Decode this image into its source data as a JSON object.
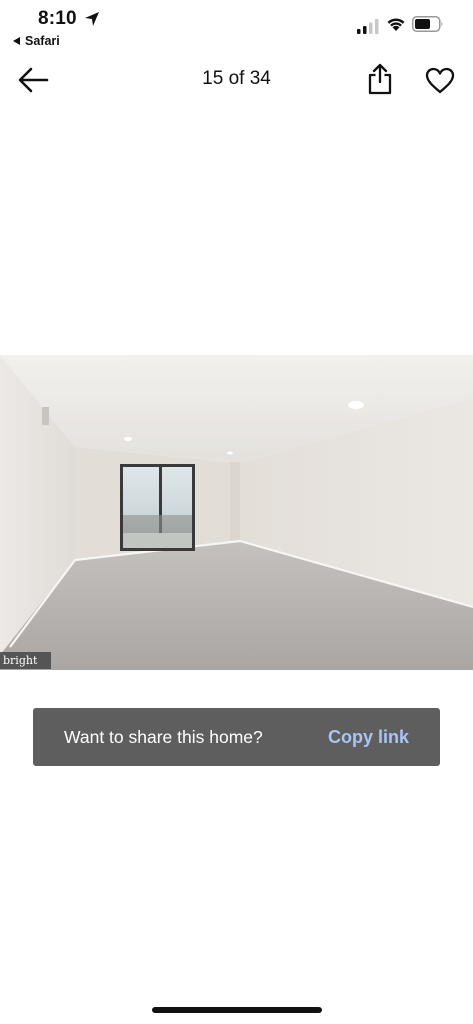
{
  "status_bar": {
    "time": "8:10",
    "back_app_label": "Safari",
    "location_icon": "location-arrow-icon",
    "signal_icon": "cellular-signal-icon",
    "wifi_icon": "wifi-icon",
    "battery_icon": "battery-icon"
  },
  "nav": {
    "back_icon": "arrow-left-icon",
    "counter": "15 of 34",
    "share_icon": "share-icon",
    "favorite_icon": "heart-icon"
  },
  "photo": {
    "subject": "empty carpeted room with window",
    "watermark": "bright MLS"
  },
  "toast": {
    "message": "Want to share this home?",
    "action": "Copy link"
  },
  "colors": {
    "toast_bg": "#5e5e5e",
    "link": "#a8c5f5",
    "wall": "#e6e1dc",
    "carpet": "#b8b4b1"
  }
}
